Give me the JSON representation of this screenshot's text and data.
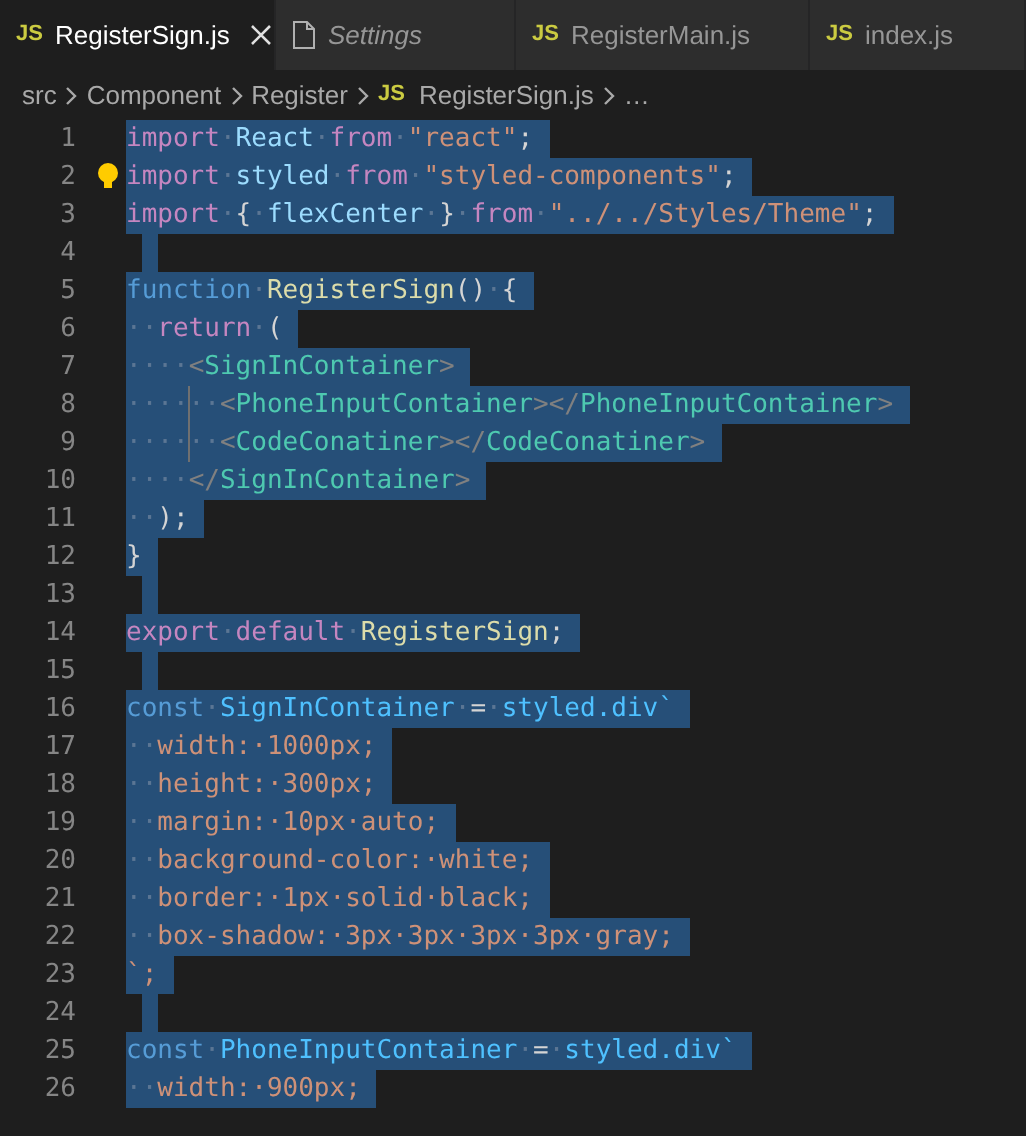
{
  "tabs": [
    {
      "kind": "js",
      "badge": "JS",
      "label": "RegisterSign.js",
      "selected": true,
      "preview": false
    },
    {
      "kind": "file",
      "label": "Settings",
      "selected": false,
      "preview": true
    },
    {
      "kind": "js",
      "badge": "JS",
      "label": "RegisterMain.js",
      "selected": false,
      "preview": false
    },
    {
      "kind": "js",
      "badge": "JS",
      "label": "index.js",
      "selected": false,
      "preview": false
    }
  ],
  "breadcrumb": [
    {
      "label": "src"
    },
    {
      "label": "Component"
    },
    {
      "label": "Register"
    },
    {
      "badge": "JS",
      "label": "RegisterSign.js"
    },
    {
      "label": "…"
    }
  ],
  "editor": {
    "lines": [
      {
        "number": "1",
        "selected": true,
        "tokens": [
          {
            "text": "import",
            "kind": "keyword"
          },
          {
            "text": "·",
            "kind": "space"
          },
          {
            "text": "React",
            "kind": "variable"
          },
          {
            "text": "·",
            "kind": "space"
          },
          {
            "text": "from",
            "kind": "keyword"
          },
          {
            "text": "·",
            "kind": "space"
          },
          {
            "text": "\"react\"",
            "kind": "string"
          },
          {
            "text": ";",
            "kind": "plain"
          }
        ]
      },
      {
        "number": "2",
        "selected": true,
        "lightbulb": true,
        "tokens": [
          {
            "text": "import",
            "kind": "keyword"
          },
          {
            "text": "·",
            "kind": "space"
          },
          {
            "text": "styled",
            "kind": "variable"
          },
          {
            "text": "·",
            "kind": "space"
          },
          {
            "text": "from",
            "kind": "keyword"
          },
          {
            "text": "·",
            "kind": "space"
          },
          {
            "text": "\"styled-components\"",
            "kind": "string"
          },
          {
            "text": ";",
            "kind": "plain"
          }
        ]
      },
      {
        "number": "3",
        "selected": true,
        "tokens": [
          {
            "text": "import",
            "kind": "keyword"
          },
          {
            "text": "·",
            "kind": "space"
          },
          {
            "text": "{",
            "kind": "plain"
          },
          {
            "text": "·",
            "kind": "space"
          },
          {
            "text": "flexCenter",
            "kind": "variable"
          },
          {
            "text": "·",
            "kind": "space"
          },
          {
            "text": "}",
            "kind": "plain"
          },
          {
            "text": "·",
            "kind": "space"
          },
          {
            "text": "from",
            "kind": "keyword"
          },
          {
            "text": "·",
            "kind": "space"
          },
          {
            "text": "\"../../Styles/Theme\"",
            "kind": "string"
          },
          {
            "text": ";",
            "kind": "plain"
          }
        ]
      },
      {
        "number": "4",
        "selected": true
      },
      {
        "number": "5",
        "selected": true,
        "tokens": [
          {
            "text": "function",
            "kind": "storage"
          },
          {
            "text": "·",
            "kind": "space"
          },
          {
            "text": "RegisterSign",
            "kind": "function"
          },
          {
            "text": "()",
            "kind": "plain"
          },
          {
            "text": "·",
            "kind": "space"
          },
          {
            "text": "{",
            "kind": "plain"
          }
        ]
      },
      {
        "number": "6",
        "selected": true,
        "tokens": [
          {
            "text": "··",
            "kind": "space"
          },
          {
            "text": "return",
            "kind": "keyword"
          },
          {
            "text": "·",
            "kind": "space"
          },
          {
            "text": "(",
            "kind": "plain"
          }
        ]
      },
      {
        "number": "7",
        "selected": true,
        "tokens": [
          {
            "text": "····",
            "kind": "space"
          },
          {
            "text": "<",
            "kind": "punct"
          },
          {
            "text": "SignInContainer",
            "kind": "tag"
          },
          {
            "text": ">",
            "kind": "punct"
          }
        ]
      },
      {
        "number": "8",
        "selected": true,
        "guide": true,
        "tokens": [
          {
            "text": "······",
            "kind": "space"
          },
          {
            "text": "<",
            "kind": "punct"
          },
          {
            "text": "PhoneInputContainer",
            "kind": "tag"
          },
          {
            "text": "></",
            "kind": "punct"
          },
          {
            "text": "PhoneInputContainer",
            "kind": "tag"
          },
          {
            "text": ">",
            "kind": "punct"
          }
        ]
      },
      {
        "number": "9",
        "selected": true,
        "guide": true,
        "tokens": [
          {
            "text": "······",
            "kind": "space"
          },
          {
            "text": "<",
            "kind": "punct"
          },
          {
            "text": "CodeConatiner",
            "kind": "tag"
          },
          {
            "text": "></",
            "kind": "punct"
          },
          {
            "text": "CodeConatiner",
            "kind": "tag"
          },
          {
            "text": ">",
            "kind": "punct"
          }
        ]
      },
      {
        "number": "10",
        "selected": true,
        "tokens": [
          {
            "text": "····",
            "kind": "space"
          },
          {
            "text": "</",
            "kind": "punct"
          },
          {
            "text": "SignInContainer",
            "kind": "tag"
          },
          {
            "text": ">",
            "kind": "punct"
          }
        ]
      },
      {
        "number": "11",
        "selected": true,
        "tokens": [
          {
            "text": "··",
            "kind": "space"
          },
          {
            "text": ");",
            "kind": "plain"
          }
        ]
      },
      {
        "number": "12",
        "selected": true,
        "tokens": [
          {
            "text": "}",
            "kind": "plain"
          }
        ]
      },
      {
        "number": "13",
        "selected": true
      },
      {
        "number": "14",
        "selected": true,
        "tokens": [
          {
            "text": "export",
            "kind": "keyword"
          },
          {
            "text": "·",
            "kind": "space"
          },
          {
            "text": "default",
            "kind": "keyword"
          },
          {
            "text": "·",
            "kind": "space"
          },
          {
            "text": "RegisterSign",
            "kind": "function"
          },
          {
            "text": ";",
            "kind": "plain"
          }
        ]
      },
      {
        "number": "15",
        "selected": true
      },
      {
        "number": "16",
        "selected": true,
        "tokens": [
          {
            "text": "const",
            "kind": "storage"
          },
          {
            "text": "·",
            "kind": "space"
          },
          {
            "text": "SignInContainer",
            "kind": "constant"
          },
          {
            "text": "·",
            "kind": "space"
          },
          {
            "text": "=",
            "kind": "plain"
          },
          {
            "text": "·",
            "kind": "space"
          },
          {
            "text": "styled.div`",
            "kind": "constant"
          }
        ]
      },
      {
        "number": "17",
        "selected": true,
        "tokens": [
          {
            "text": "··",
            "kind": "space"
          },
          {
            "text": "width:·1000px;",
            "kind": "css"
          }
        ]
      },
      {
        "number": "18",
        "selected": true,
        "tokens": [
          {
            "text": "··",
            "kind": "space"
          },
          {
            "text": "height:·300px;",
            "kind": "css"
          }
        ]
      },
      {
        "number": "19",
        "selected": true,
        "tokens": [
          {
            "text": "··",
            "kind": "space"
          },
          {
            "text": "margin:·10px·auto;",
            "kind": "css"
          }
        ]
      },
      {
        "number": "20",
        "selected": true,
        "tokens": [
          {
            "text": "··",
            "kind": "space"
          },
          {
            "text": "background-color:·white;",
            "kind": "css"
          }
        ]
      },
      {
        "number": "21",
        "selected": true,
        "tokens": [
          {
            "text": "··",
            "kind": "space"
          },
          {
            "text": "border:·1px·solid·black;",
            "kind": "css"
          }
        ]
      },
      {
        "number": "22",
        "selected": true,
        "tokens": [
          {
            "text": "··",
            "kind": "space"
          },
          {
            "text": "box-shadow:·3px·3px·3px·3px·gray;",
            "kind": "css"
          }
        ]
      },
      {
        "number": "23",
        "selected": true,
        "tokens": [
          {
            "text": "`;",
            "kind": "css"
          }
        ]
      },
      {
        "number": "24",
        "selected": true
      },
      {
        "number": "25",
        "selected": true,
        "tokens": [
          {
            "text": "const",
            "kind": "storage"
          },
          {
            "text": "·",
            "kind": "space"
          },
          {
            "text": "PhoneInputContainer",
            "kind": "constant"
          },
          {
            "text": "·",
            "kind": "space"
          },
          {
            "text": "=",
            "kind": "plain"
          },
          {
            "text": "·",
            "kind": "space"
          },
          {
            "text": "styled.div`",
            "kind": "constant"
          }
        ]
      },
      {
        "number": "26",
        "selected": true,
        "tokens": [
          {
            "text": "··",
            "kind": "space"
          },
          {
            "text": "width:·900px;",
            "kind": "css"
          }
        ]
      }
    ]
  }
}
